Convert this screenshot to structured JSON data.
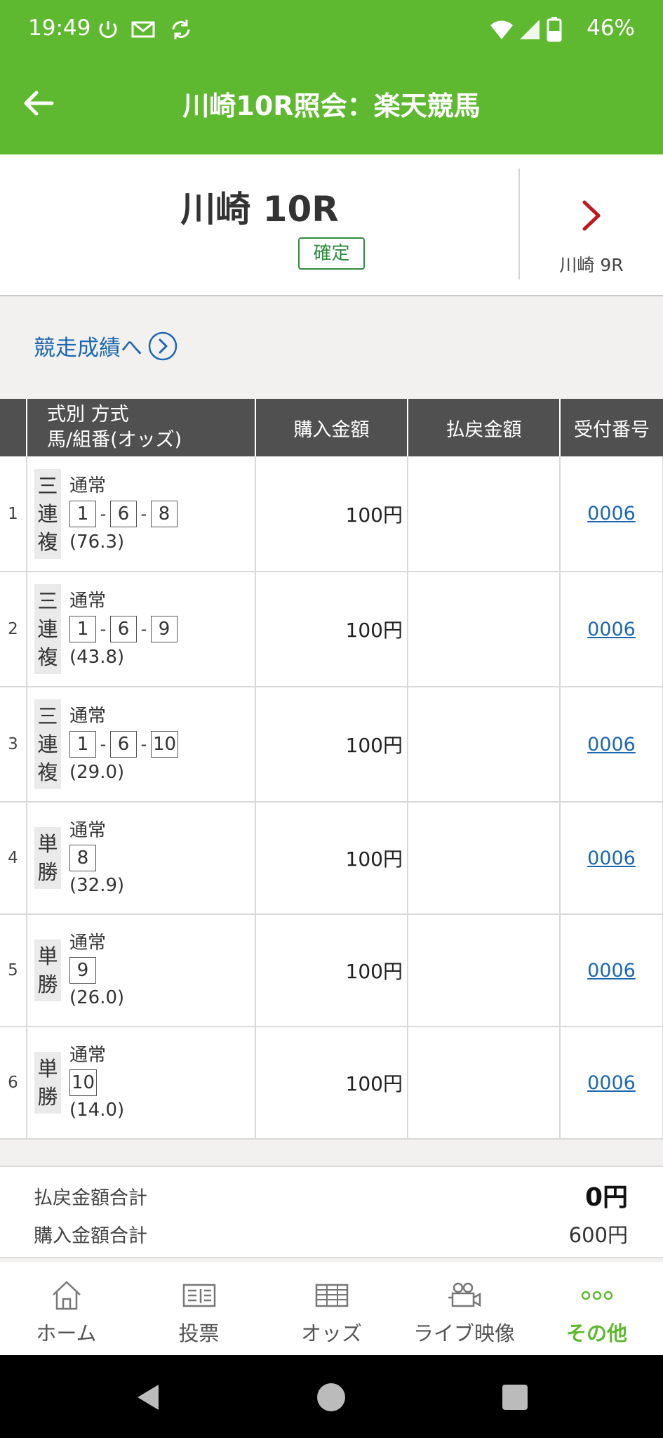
{
  "status_bar": {
    "time": "19:49",
    "battery": "46%"
  },
  "app_bar": {
    "title": "川崎10R照会：楽天競馬"
  },
  "race": {
    "name": "川崎 10R",
    "status": "確定",
    "next_label": "川崎 9R"
  },
  "results_link": "競走成績へ",
  "table": {
    "headers": {
      "kind_line1": "式別 方式",
      "kind_line2": "馬/組番(オッズ)",
      "purchase": "購入金額",
      "payout": "払戻金額",
      "receipt": "受付番号"
    },
    "rows": [
      {
        "idx": "1",
        "type": [
          "三",
          "連",
          "複"
        ],
        "method": "通常",
        "nums": [
          "1",
          "6",
          "8"
        ],
        "odds": "(76.3)",
        "amount": "100円",
        "payout": "",
        "receipt": "0006"
      },
      {
        "idx": "2",
        "type": [
          "三",
          "連",
          "複"
        ],
        "method": "通常",
        "nums": [
          "1",
          "6",
          "9"
        ],
        "odds": "(43.8)",
        "amount": "100円",
        "payout": "",
        "receipt": "0006"
      },
      {
        "idx": "3",
        "type": [
          "三",
          "連",
          "複"
        ],
        "method": "通常",
        "nums": [
          "1",
          "6",
          "10"
        ],
        "odds": "(29.0)",
        "amount": "100円",
        "payout": "",
        "receipt": "0006"
      },
      {
        "idx": "4",
        "type": [
          "単",
          "勝"
        ],
        "method": "通常",
        "nums": [
          "8"
        ],
        "odds": "(32.9)",
        "amount": "100円",
        "payout": "",
        "receipt": "0006"
      },
      {
        "idx": "5",
        "type": [
          "単",
          "勝"
        ],
        "method": "通常",
        "nums": [
          "9"
        ],
        "odds": "(26.0)",
        "amount": "100円",
        "payout": "",
        "receipt": "0006"
      },
      {
        "idx": "6",
        "type": [
          "単",
          "勝"
        ],
        "method": "通常",
        "nums": [
          "10"
        ],
        "odds": "(14.0)",
        "amount": "100円",
        "payout": "",
        "receipt": "0006"
      }
    ]
  },
  "totals": {
    "payout_label": "払戻金額合計",
    "payout_value": "0円",
    "purchase_label": "購入金額合計",
    "purchase_value": "600円"
  },
  "tabs": [
    {
      "label": "ホーム",
      "icon": "home-icon",
      "active": false
    },
    {
      "label": "投票",
      "icon": "ticket-icon",
      "active": false
    },
    {
      "label": "オッズ",
      "icon": "odds-table-icon",
      "active": false
    },
    {
      "label": "ライブ映像",
      "icon": "video-camera-icon",
      "active": false
    },
    {
      "label": "その他",
      "icon": "more-icon",
      "active": true
    }
  ],
  "colors": {
    "brand_green": "#5fb930",
    "link_blue": "#1d67b1",
    "header_gray": "#505050",
    "next_red": "#c0181f",
    "confirmed_green": "#2e8b3e"
  }
}
